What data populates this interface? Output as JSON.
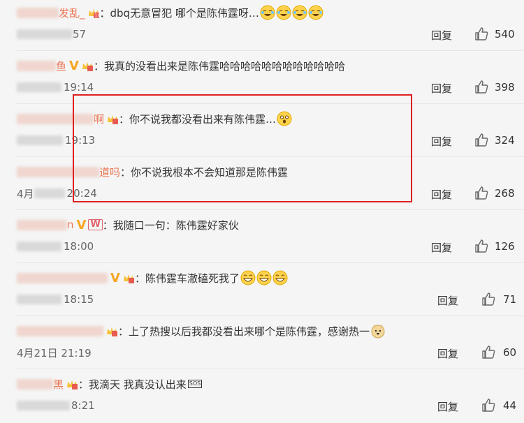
{
  "comments": [
    {
      "name_visible": "发乱_",
      "text": "：dbq无意冒犯 哪个是陈伟霆呀…",
      "time_visible": "57",
      "reply": "回复",
      "likes": "540",
      "emoji_count": 4
    },
    {
      "name_visible": "鱼",
      "text": "：我真的没看出来是陈伟霆哈哈哈哈哈哈哈哈哈哈哈哈",
      "time_visible": "19:14",
      "reply": "回复",
      "likes": "398"
    },
    {
      "name_visible": "啊",
      "text": "：你不说我都没看出来有陈伟霆…",
      "time_visible": "19:13",
      "reply": "回复",
      "likes": "324"
    },
    {
      "name_visible": "道吗",
      "text": "：你不说我根本不会知道那是陈伟霆",
      "time_visible": "20:24",
      "time_prefix": "4月",
      "reply": "回复",
      "likes": "268"
    },
    {
      "name_visible": "n",
      "text": "：我随口一句：陈伟霆好家伙",
      "time_visible": "18:00",
      "reply": "回复",
      "likes": "126"
    },
    {
      "name_visible": "",
      "text": "：陈伟霆车澈磕死我了",
      "time_visible": "18:15",
      "reply": "回复",
      "likes": "71"
    },
    {
      "name_visible": "",
      "text": "：上了热搜以后我都没看出来哪个是陈伟霆，感谢热一",
      "time_visible": "4月21日 21:19",
      "reply": "回复",
      "likes": "60"
    },
    {
      "name_visible": "黑",
      "text": "：我滴天 我真没认出来",
      "time_visible": "8:21",
      "reply": "回复",
      "likes": "44"
    }
  ],
  "labels": {
    "sos": "SOS",
    "vip_v": "V",
    "vip_w": "W"
  },
  "colors": {
    "name": "#eb7350",
    "highlight": "#e02020",
    "background": "#f5f5f5"
  }
}
